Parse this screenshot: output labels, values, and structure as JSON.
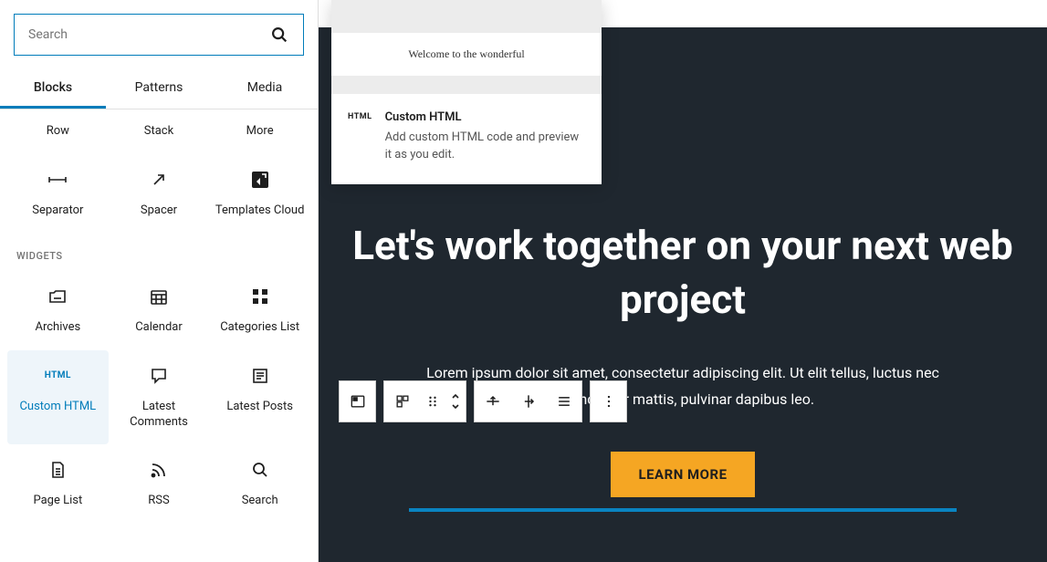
{
  "search": {
    "placeholder": "Search"
  },
  "tabs": {
    "blocks": "Blocks",
    "patterns": "Patterns",
    "media": "Media"
  },
  "row1": {
    "row": "Row",
    "stack": "Stack",
    "more": "More"
  },
  "row2": {
    "separator": "Separator",
    "spacer": "Spacer",
    "templates": "Templates Cloud"
  },
  "widgets_hdr": "WIDGETS",
  "widgets": {
    "archives": "Archives",
    "calendar": "Calendar",
    "categories": "Categories List",
    "custom_html": "Custom HTML",
    "latest_comments": "Latest Comments",
    "latest_posts": "Latest Posts",
    "page_list": "Page List",
    "rss": "RSS",
    "search": "Search"
  },
  "html_glyph": "HTML",
  "preview": {
    "welcome": "Welcome to the wonderful",
    "badge": "HTML",
    "title": "Custom HTML",
    "desc": "Add custom HTML code and preview it as you edit."
  },
  "hero": {
    "title": "Let's work together on your next web project",
    "sub": "Lorem ipsum dolor sit amet, consectetur adipiscing elit. Ut elit tellus, luctus nec ullamcorper mattis, pulvinar dapibus leo.",
    "cta": "LEARN MORE"
  }
}
